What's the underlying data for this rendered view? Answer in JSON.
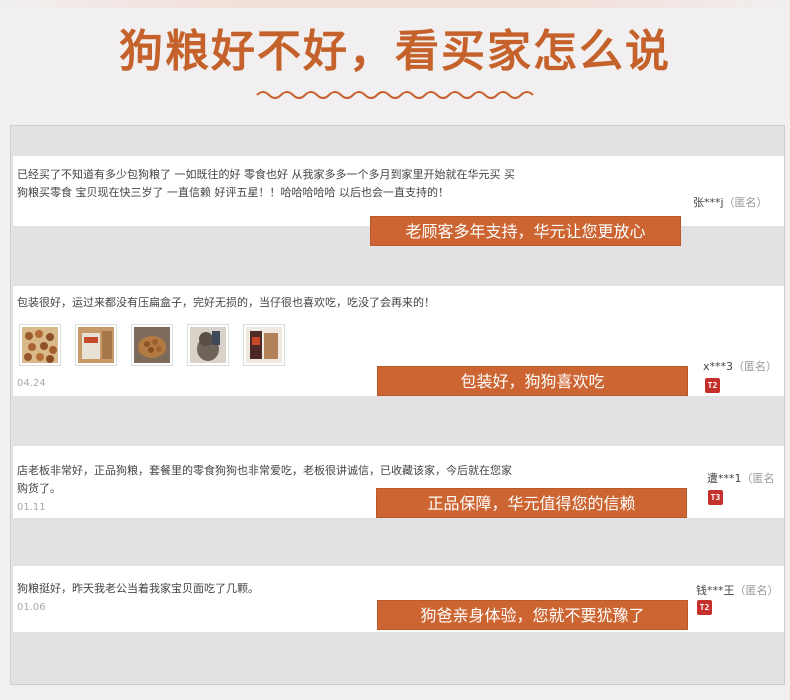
{
  "header": {
    "title": "狗粮好不好，看买家怎么说"
  },
  "reviews": [
    {
      "text": "已经买了不知道有多少包狗粮了 一如既往的好 零食也好 从我家多多一个多月到家里开始就在华元买 买狗粮买零食 宝贝现在快三岁了 一直信赖 好评五星！！哈哈哈哈哈 以后也会一直支持的！",
      "reviewer": "张***j",
      "anon": "（匿名）",
      "caption": "老顾客多年支持，华元让您更放心"
    },
    {
      "text": "包装很好，运过来都没有压扁盒子，完好无损的，当仔很也喜欢吃，吃没了会再来的！",
      "date": "04.24",
      "reviewer": "x***3",
      "anon": "（匿名）",
      "badge": "T2",
      "caption": "包装好，狗狗喜欢吃",
      "photos": [
        "kibble-photo",
        "box-photo",
        "kibble-bowl-photo",
        "dog-photo",
        "bag-photo"
      ]
    },
    {
      "text": "店老板非常好，正品狗粮，套餐里的零食狗狗也非常爱吃，老板很讲诚信，已收藏该家，今后就在您家购货了。",
      "date": "01.11",
      "reviewer": "遭***1",
      "anon": "（匿名",
      "badge": "T3",
      "caption": "正品保障，华元值得您的信赖"
    },
    {
      "text": "狗粮挺好，昨天我老公当着我家宝贝面吃了几颗。",
      "date": "01.06",
      "reviewer": "钱***王",
      "anon": "（匿名）",
      "badge": "T2",
      "caption": "狗爸亲身体验，您就不要犹豫了"
    }
  ],
  "colors": {
    "title": "#c5612b",
    "caption_bg": "#cc6532",
    "badge": "#c4302c",
    "page_bg": "#f1efef",
    "panel_bg": "#e3e1e1"
  }
}
